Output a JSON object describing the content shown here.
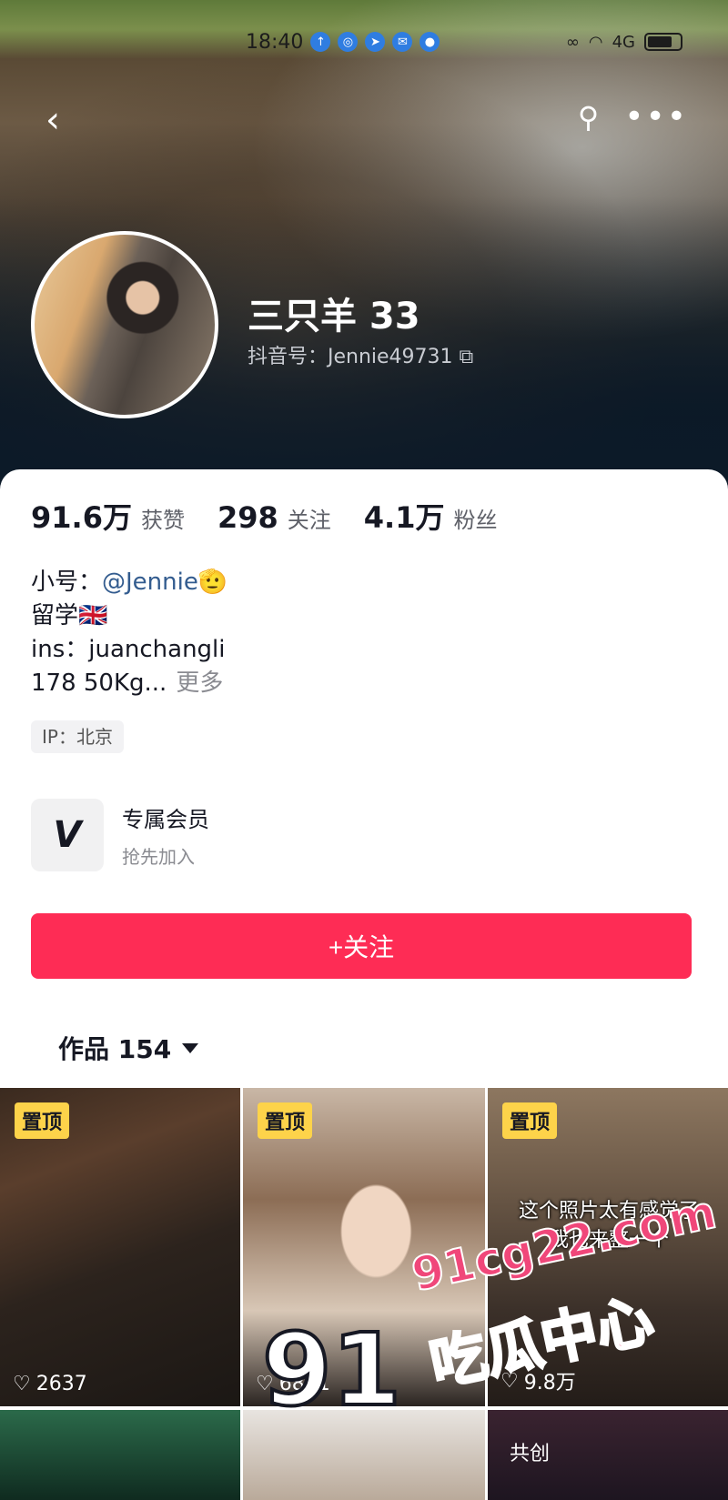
{
  "status_bar": {
    "time": "18:40",
    "network": "4G"
  },
  "profile": {
    "name": "三只羊 33",
    "douyin_id": "抖音号：Jennie49731"
  },
  "stats": [
    {
      "value": "91.6万",
      "label": "获赞"
    },
    {
      "value": "298",
      "label": "关注"
    },
    {
      "value": "4.1万",
      "label": "粉丝"
    }
  ],
  "bio": {
    "line1_prefix": "小号：",
    "line1_link": "@Jennie",
    "line2": "留学🇬🇧",
    "line3": "ins：juanchangli",
    "line4": "178 50Kg...",
    "more": "更多"
  },
  "ip": "IP：北京",
  "membership": {
    "title": "专属会员",
    "subtitle": "抢先加入"
  },
  "follow_button": "+关注",
  "works_tab": "作品 154",
  "videos": [
    {
      "badge": "置顶",
      "likes": "2637",
      "caption": ""
    },
    {
      "badge": "置顶",
      "likes": "6861",
      "caption": ""
    },
    {
      "badge": "置顶",
      "likes": "9.8万",
      "caption": "这个照片太有感觉了\n我也来整一个"
    }
  ],
  "row2_label": "共创",
  "watermark": {
    "number": "91",
    "site": "91cg22.com",
    "name": "吃瓜中心"
  }
}
